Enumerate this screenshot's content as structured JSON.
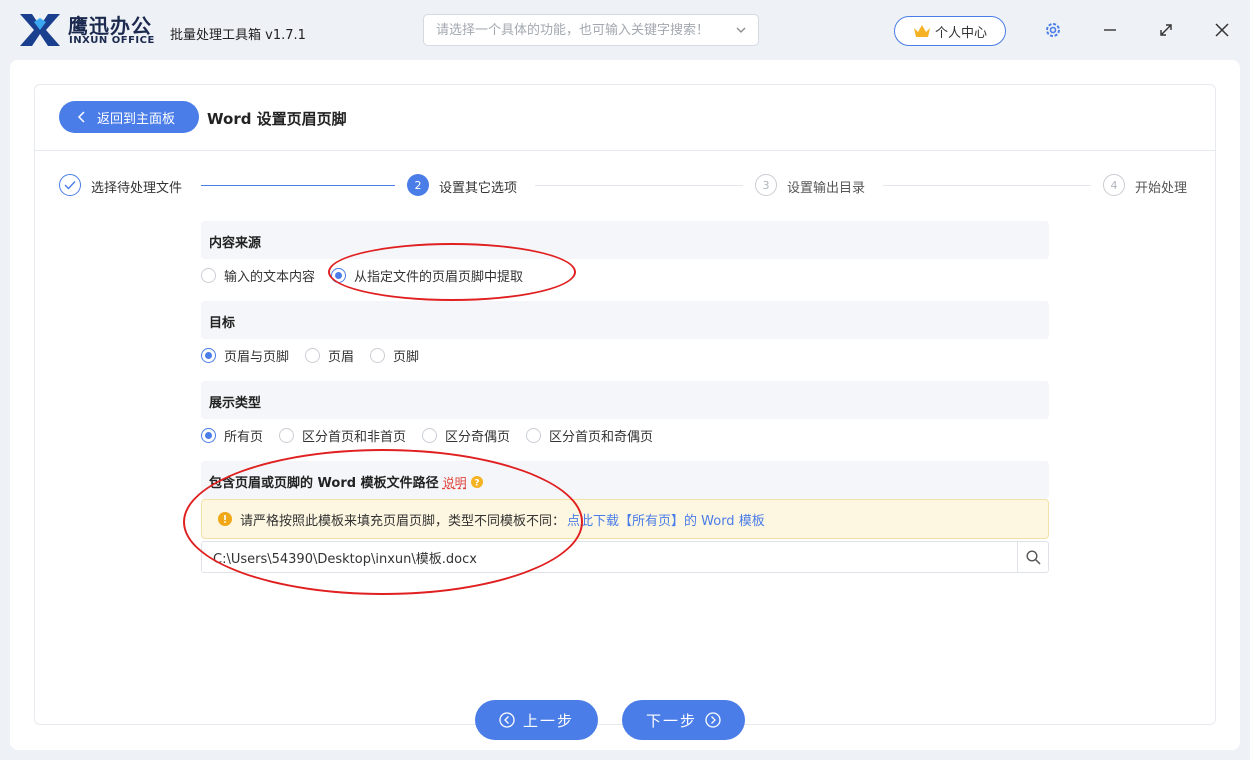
{
  "app": {
    "brand_cn": "鹰迅办公",
    "brand_en": "INXUN OFFICE",
    "name": "批量处理工具箱 v1.7.1",
    "search_placeholder": "请选择一个具体的功能，也可输入关键字搜索！",
    "user_center": "个人中心"
  },
  "header": {
    "back_label": "返回到主面板",
    "title": "Word 设置页眉页脚"
  },
  "steps": [
    {
      "num": "1",
      "label": "选择待处理文件",
      "state": "done"
    },
    {
      "num": "2",
      "label": "设置其它选项",
      "state": "active"
    },
    {
      "num": "3",
      "label": "设置输出目录",
      "state": "todo"
    },
    {
      "num": "4",
      "label": "开始处理",
      "state": "todo"
    }
  ],
  "sections": {
    "source": {
      "title": "内容来源",
      "options": [
        "输入的文本内容",
        "从指定文件的页眉页脚中提取"
      ],
      "selected": 1
    },
    "target": {
      "title": "目标",
      "options": [
        "页眉与页脚",
        "页眉",
        "页脚"
      ],
      "selected": 0
    },
    "display": {
      "title": "展示类型",
      "options": [
        "所有页",
        "区分首页和非首页",
        "区分奇偶页",
        "区分首页和奇偶页"
      ],
      "selected": 0
    },
    "template": {
      "title": "包含页眉或页脚的 Word 模板文件路径",
      "hint": "说明",
      "warning": "请严格按照此模板来填充页眉页脚，类型不同模板不同：",
      "warning_link": "点此下载【所有页】的 Word 模板",
      "path_value": "C:\\Users\\54390\\Desktop\\inxun\\模板.docx"
    }
  },
  "nav": {
    "prev": "上一步",
    "next": "下一步"
  },
  "colors": {
    "accent": "#4a7de8",
    "annotation": "#e02020",
    "warning_bg": "#fdf6e0"
  }
}
